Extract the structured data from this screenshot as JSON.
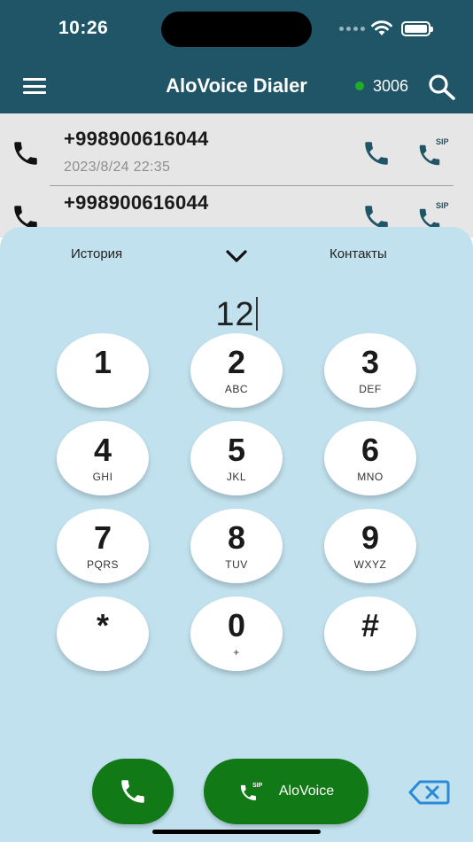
{
  "status_bar": {
    "time": "10:26"
  },
  "header": {
    "title": "AloVoice Dialer",
    "extension": "3006",
    "status_color": "#1fae2a"
  },
  "history": [
    {
      "number": "+998900616044",
      "datetime": "2023/8/24  22:35"
    },
    {
      "number": "+998900616044",
      "datetime": ""
    }
  ],
  "dialer": {
    "tabs": {
      "history": "История",
      "contacts": "Контакты"
    },
    "display_value": "12",
    "keys": [
      {
        "digit": "1",
        "letters": ""
      },
      {
        "digit": "2",
        "letters": "ABC"
      },
      {
        "digit": "3",
        "letters": "DEF"
      },
      {
        "digit": "4",
        "letters": "GHI"
      },
      {
        "digit": "5",
        "letters": "JKL"
      },
      {
        "digit": "6",
        "letters": "MNO"
      },
      {
        "digit": "7",
        "letters": "PQRS"
      },
      {
        "digit": "8",
        "letters": "TUV"
      },
      {
        "digit": "9",
        "letters": "WXYZ"
      },
      {
        "digit": "*",
        "letters": ""
      },
      {
        "digit": "0",
        "letters": "+"
      },
      {
        "digit": "#",
        "letters": ""
      }
    ],
    "alovoice_label": "AloVoice",
    "sip_badge": "SIP"
  },
  "colors": {
    "header_bg": "#1f5566",
    "sheet_bg": "#c1e1ee",
    "call_green": "#117a17",
    "icon_blue": "#1f5566"
  },
  "icons": {
    "call": "phone-icon",
    "sip": "sip-phone-icon",
    "search": "search-icon",
    "backspace": "backspace-icon"
  }
}
